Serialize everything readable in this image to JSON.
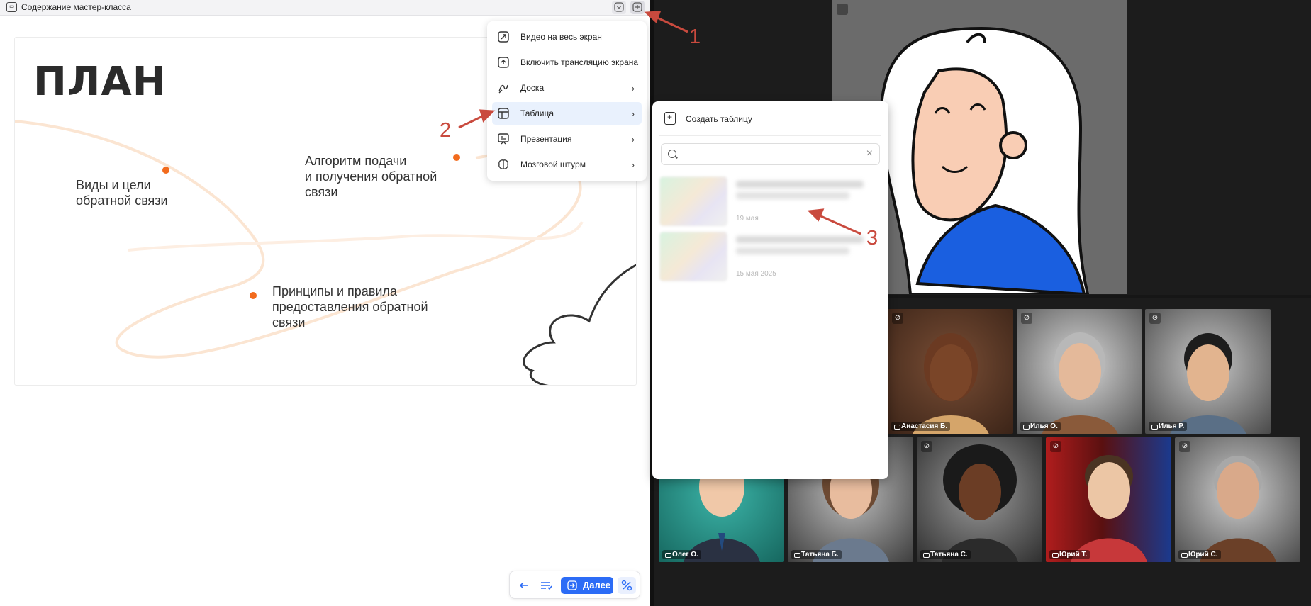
{
  "topbar": {
    "title": "Содержание мастер-класса",
    "doc_icon": "presentation-icon",
    "collapse_icon": "chevron-down-icon",
    "add_icon": "plus-icon"
  },
  "slide": {
    "title": "ПЛАН",
    "point1": "Виды и цели\nобратной связи",
    "point2": "Алгоритм подачи\nи получения обратной\nсвязи",
    "point3": "Принципы и правила\nпредоставления обратной\nсвязи",
    "accent_color": "#f26b1d"
  },
  "menu": {
    "items": [
      {
        "label": "Видео на весь экран",
        "icon": "expand-icon",
        "has_submenu": false
      },
      {
        "label": "Включить трансляцию экрана",
        "icon": "screen-share-icon",
        "has_submenu": false
      },
      {
        "label": "Доска",
        "icon": "whiteboard-icon",
        "has_submenu": true
      },
      {
        "label": "Таблица",
        "icon": "table-icon",
        "has_submenu": true
      },
      {
        "label": "Презентация",
        "icon": "presentation-icon",
        "has_submenu": true
      },
      {
        "label": "Мозговой штурм",
        "icon": "brain-icon",
        "has_submenu": true
      }
    ],
    "chevron": "›"
  },
  "table_popover": {
    "create_label": "Создать таблицу",
    "search_placeholder": "",
    "clear": "×",
    "files": [
      {
        "date": "19 мая"
      },
      {
        "date": "15 мая 2025"
      }
    ]
  },
  "bottom_bar": {
    "next_label": "Далее",
    "accent": "#2c6cf6"
  },
  "participants": [
    {
      "name": "Анастасия Б."
    },
    {
      "name": "Илья О."
    },
    {
      "name": "Илья Р."
    },
    {
      "name": "Олег О."
    },
    {
      "name": "Татьяна Б."
    },
    {
      "name": "Татьяна С."
    },
    {
      "name": "Юрий Т."
    },
    {
      "name": "Юрий С."
    }
  ],
  "annotations": {
    "one": "1",
    "two": "2",
    "three": "3",
    "color": "#c94a3e"
  }
}
